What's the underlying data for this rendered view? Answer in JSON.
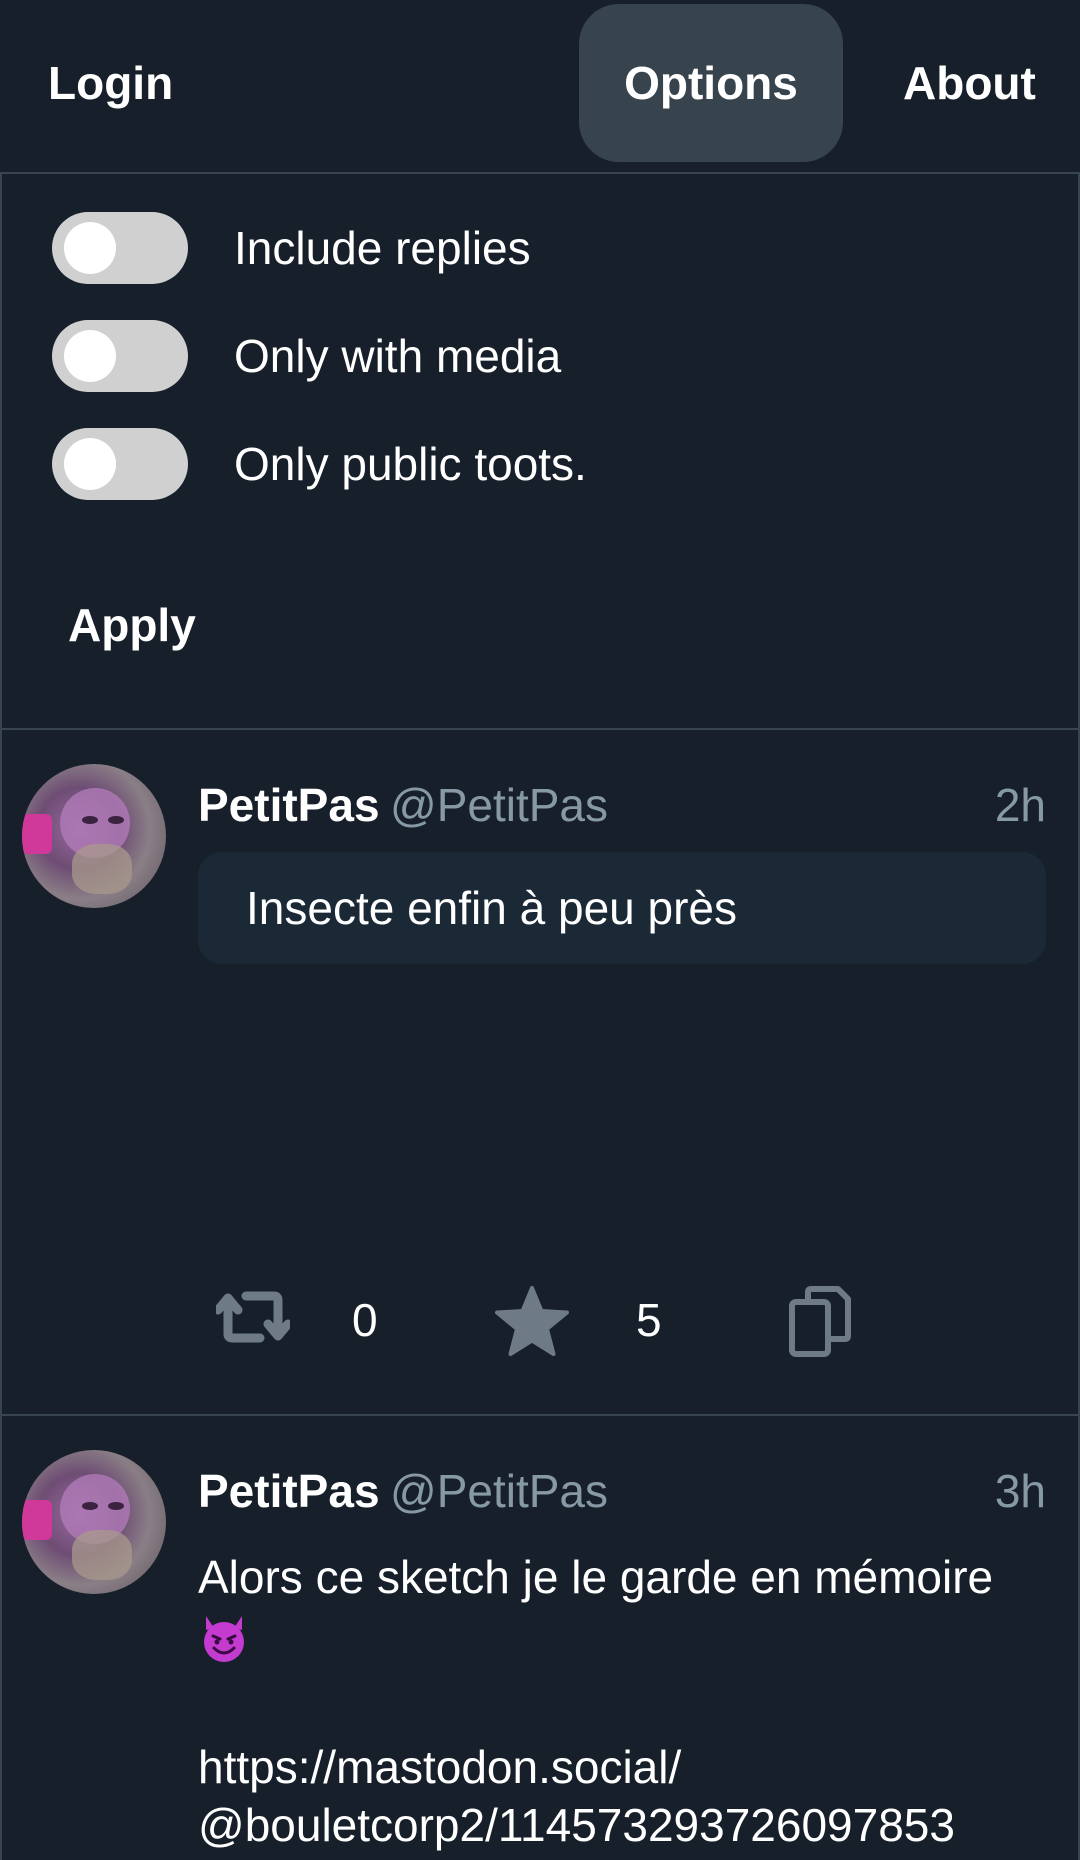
{
  "nav": {
    "login": "Login",
    "options": "Options",
    "about": "About"
  },
  "options_panel": {
    "toggles": [
      {
        "label": "Include replies",
        "on": false
      },
      {
        "label": "Only with media",
        "on": false
      },
      {
        "label": "Only public toots.",
        "on": false
      }
    ],
    "apply": "Apply"
  },
  "posts": [
    {
      "display_name": "PetitPas",
      "handle": "@PetitPas",
      "time": "2h",
      "content": "Insecte enfin à peu près",
      "boost_count": "0",
      "fav_count": "5",
      "icons": [
        "boost-icon",
        "star-icon",
        "copy-icon"
      ]
    },
    {
      "display_name": "PetitPas",
      "handle": "@PetitPas",
      "time": "3h",
      "content": "Alors ce sketch je le garde en mémoire",
      "emoji": "smiling-devil-emoji",
      "link_line1": "https://mastodon.social/",
      "link_line2": "@bouletcorp2/114573293726097853"
    }
  ],
  "colors": {
    "background": "#17202a",
    "border": "#38444d",
    "muted": "#8899a6",
    "content_box": "#1b2836",
    "toggle_off": "#d0d0d0",
    "icon": "#6e7a86"
  }
}
